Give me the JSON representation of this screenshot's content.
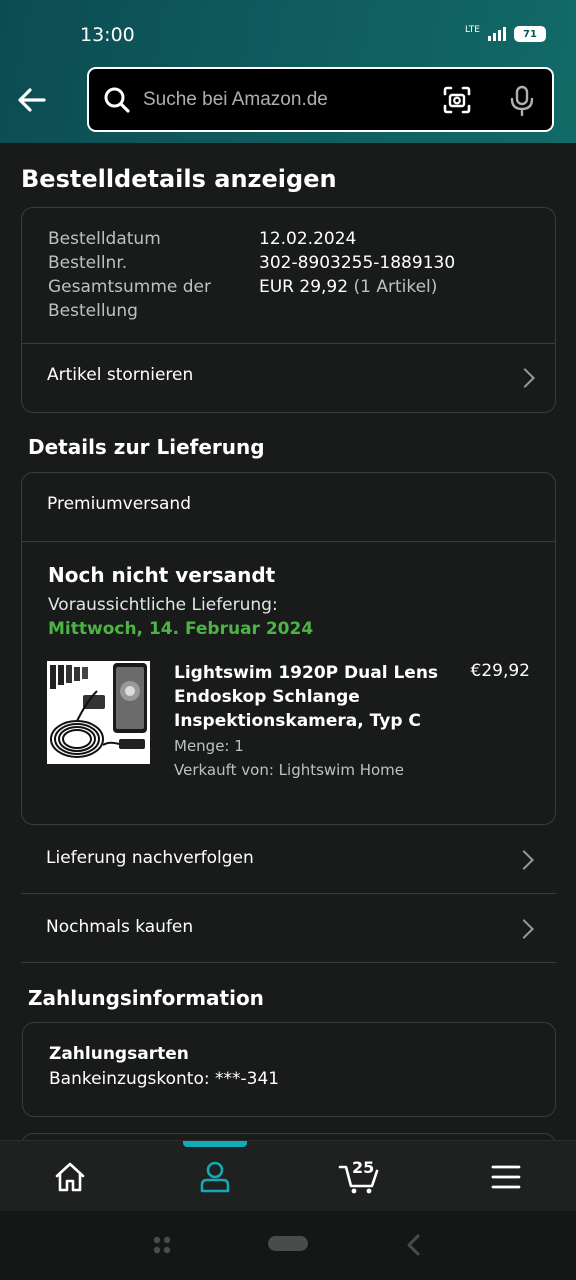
{
  "status_bar": {
    "time": "13:00",
    "network": "LTE",
    "battery": "71"
  },
  "search": {
    "placeholder": "Suche bei Amazon.de"
  },
  "page": {
    "title": "Bestelldetails anzeigen"
  },
  "order": {
    "date_label": "Bestelldatum",
    "date_value": "12.02.2024",
    "number_label": "Bestellnr.",
    "number_value": "302-8903255-1889130",
    "total_label_line1": "Gesamtsumme der",
    "total_label_line2": "Bestellung",
    "total_value": "EUR 29,92",
    "total_items": "(1 Artikel)",
    "cancel_label": "Artikel stornieren"
  },
  "delivery": {
    "section_title": "Details zur Lieferung",
    "shipping_method": "Premiumversand",
    "status": "Noch nicht versandt",
    "expected_label": "Voraussichtliche Lieferung:",
    "expected_date": "Mittwoch, 14. Februar 2024",
    "product": {
      "title": "Lightswim 1920P Dual Lens Endoskop Schlange Inspektionskamera, Typ C",
      "price": "€29,92",
      "quantity": "Menge: 1",
      "seller": "Verkauft von: Lightswim Home"
    },
    "track_label": "Lieferung nachverfolgen",
    "buy_again_label": "Nochmals kaufen"
  },
  "payment": {
    "section_title": "Zahlungsinformation",
    "methods_heading": "Zahlungsarten",
    "method_value": "Bankeinzugskonto: ***-341"
  },
  "bottom_nav": {
    "cart_count": "25",
    "active": "profile",
    "active_color": "#12a9b9"
  },
  "colors": {
    "header_gradient_start": "#0b4c52",
    "header_gradient_end": "#126a67",
    "background": "#191a1a",
    "delivery_date_green": "#4bb543"
  }
}
